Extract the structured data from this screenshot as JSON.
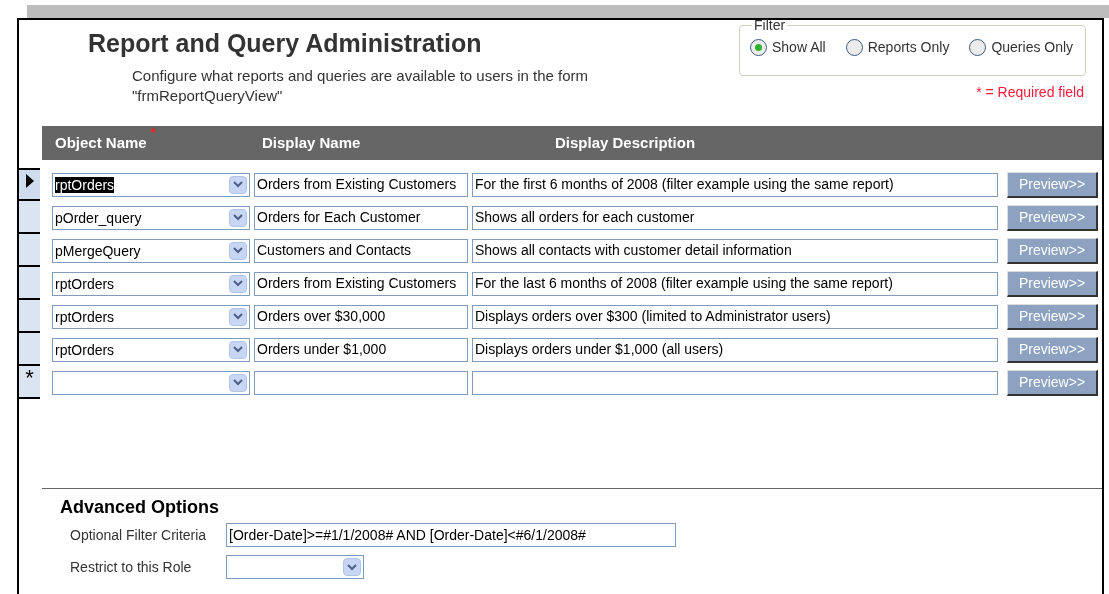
{
  "title": "Report and Query Administration",
  "subtitle_lines": [
    "Configure what reports and queries are available to users in the form",
    "\"frmReportQueryView\""
  ],
  "filter": {
    "legend": "Filter",
    "options": [
      {
        "label": "Show All",
        "selected": true
      },
      {
        "label": "Reports Only",
        "selected": false
      },
      {
        "label": "Queries Only",
        "selected": false
      }
    ]
  },
  "required_note": "* = Required field",
  "table": {
    "columns": [
      {
        "label": "Object Name",
        "required_mark": "*"
      },
      {
        "label": "Display Name"
      },
      {
        "label": "Display Description"
      }
    ],
    "rows": [
      {
        "kind": "record",
        "selected": true,
        "object_name": "rptOrders",
        "display_name": "Orders from Existing Customers",
        "description": "For the first 6 months of 2008 (filter example using the same report)",
        "button": "Preview>>"
      },
      {
        "kind": "record",
        "selected": false,
        "object_name": "pOrder_query",
        "display_name": "Orders for Each Customer",
        "description": "Shows all orders for each customer",
        "button": "Preview>>"
      },
      {
        "kind": "record",
        "selected": false,
        "object_name": "pMergeQuery",
        "display_name": "Customers and Contacts",
        "description": "Shows all contacts with customer detail information",
        "button": "Preview>>"
      },
      {
        "kind": "record",
        "selected": false,
        "object_name": "rptOrders",
        "display_name": "Orders from Existing Customers",
        "description": "For the last 6 months of 2008 (filter example using the same report)",
        "button": "Preview>>"
      },
      {
        "kind": "record",
        "selected": false,
        "object_name": "rptOrders",
        "display_name": "Orders over $30,000",
        "description": "Displays orders over $300 (limited to Administrator users)",
        "button": "Preview>>"
      },
      {
        "kind": "record",
        "selected": false,
        "object_name": "rptOrders",
        "display_name": "Orders under $1,000",
        "description": "Displays orders under $1,000 (all users)",
        "button": "Preview>>"
      },
      {
        "kind": "new",
        "selected": false,
        "marker": "*",
        "button": "Preview>>"
      }
    ]
  },
  "advanced": {
    "title": "Advanced Options",
    "filter_criteria": {
      "label": "Optional Filter Criteria",
      "value": "[Order-Date]>=#1/1/2008# AND [Order-Date]<#6/1/2008#"
    },
    "role": {
      "label": "Restrict to this Role"
    }
  }
}
